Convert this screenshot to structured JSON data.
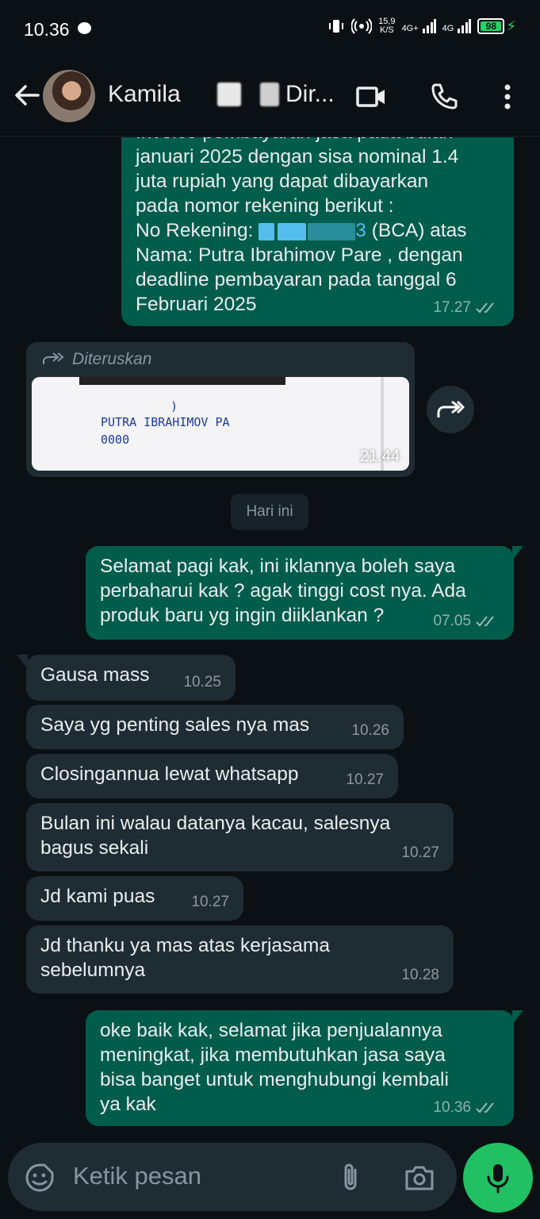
{
  "status_bar": {
    "time": "10.36",
    "speed": "15,9",
    "speed_unit": "K/S",
    "net1": "4G+",
    "net2": "4G",
    "battery": "98"
  },
  "header": {
    "contact_name": "Kamila",
    "contact_suffix": "Dir..."
  },
  "messages": {
    "m1": {
      "lines": [
        "Invoice pembayaran jasa pada bulan",
        "januari 2025 dengan sisa nominal 1.4",
        "juta rupiah yang dapat dibayarkan",
        "pada nomor rekening berikut :"
      ],
      "rek_label": "No Rekening:",
      "rek_end": "3",
      "rek_bank": "(BCA) atas",
      "line_nama": "Nama: Putra Ibrahimov Pare , dengan",
      "line_deadline": "deadline pembayaran pada tanggal 6",
      "line_feb": "Februari 2025",
      "time": "17.27"
    },
    "forward": {
      "label": "Diteruskan",
      "img_text1": ")",
      "img_text2": "PUTRA IBRAHIMOV PA",
      "img_text3": "0000",
      "time": "21.44"
    },
    "date_chip": "Hari ini",
    "m2": {
      "lines": [
        "Selamat pagi kak, ini iklannya boleh saya",
        "perbaharui kak ? agak tinggi cost nya. Ada",
        "produk baru yg ingin diiklankan ?"
      ],
      "time": "07.05"
    },
    "r1": {
      "text": "Gausa mass",
      "time": "10.25"
    },
    "r2": {
      "text": "Saya yg penting sales nya mas",
      "time": "10.26"
    },
    "r3": {
      "text": "Closingannua lewat whatsapp",
      "time": "10.27"
    },
    "r4": {
      "lines": [
        "Bulan ini walau datanya kacau, salesnya",
        "bagus sekali"
      ],
      "time": "10.27"
    },
    "r5": {
      "text": "Jd kami puas",
      "time": "10.27"
    },
    "r6": {
      "lines": [
        "Jd thanku ya mas atas kerjasama",
        "sebelumnya"
      ],
      "time": "10.28"
    },
    "m3": {
      "lines": [
        "oke baik kak, selamat jika penjualannya",
        "meningkat, jika membutuhkan jasa saya",
        "bisa banget untuk menghubungi kembali",
        "ya kak"
      ],
      "time": "10.36"
    }
  },
  "input": {
    "placeholder": "Ketik pesan"
  },
  "colors": {
    "outgoing": "#005c4b",
    "incoming": "#202c33",
    "accent": "#21c063",
    "link": "#53bdeb"
  }
}
